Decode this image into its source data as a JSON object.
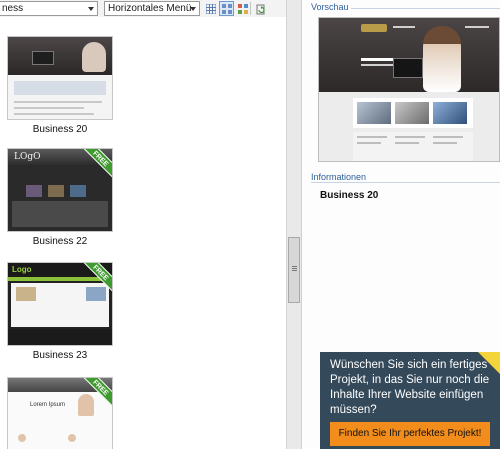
{
  "toolbar": {
    "category_select": "ness",
    "menu_select": "Horizontales Menü",
    "view_buttons": [
      "grid-view",
      "thumbnail-view",
      "large-view"
    ],
    "refresh": "refresh"
  },
  "gallery": {
    "items": [
      {
        "label": "Business 20",
        "free": ""
      },
      {
        "label": "Business 22",
        "free": "FREE",
        "logo": "LOgO"
      },
      {
        "label": "Business 23",
        "free": "FREE",
        "logo": "Logo"
      },
      {
        "label": "",
        "free": "FREE",
        "title": "Lorem Ipsum"
      }
    ]
  },
  "right": {
    "preview_heading": "Vorschau",
    "info_heading": "Informationen",
    "selected_name": "Business 20",
    "promo": {
      "text": "Wünschen Sie sich ein fertiges Projekt, in das Sie nur noch die Inhalte Ihrer Website einfügen müssen?",
      "button": "Finden Sie Ihr perfektes Projekt!"
    }
  },
  "colors": {
    "accent": "#2f5e9e",
    "promo_bg": "#34495a",
    "promo_button": "#f28c1a",
    "free_badge": "#3f9a2f"
  }
}
